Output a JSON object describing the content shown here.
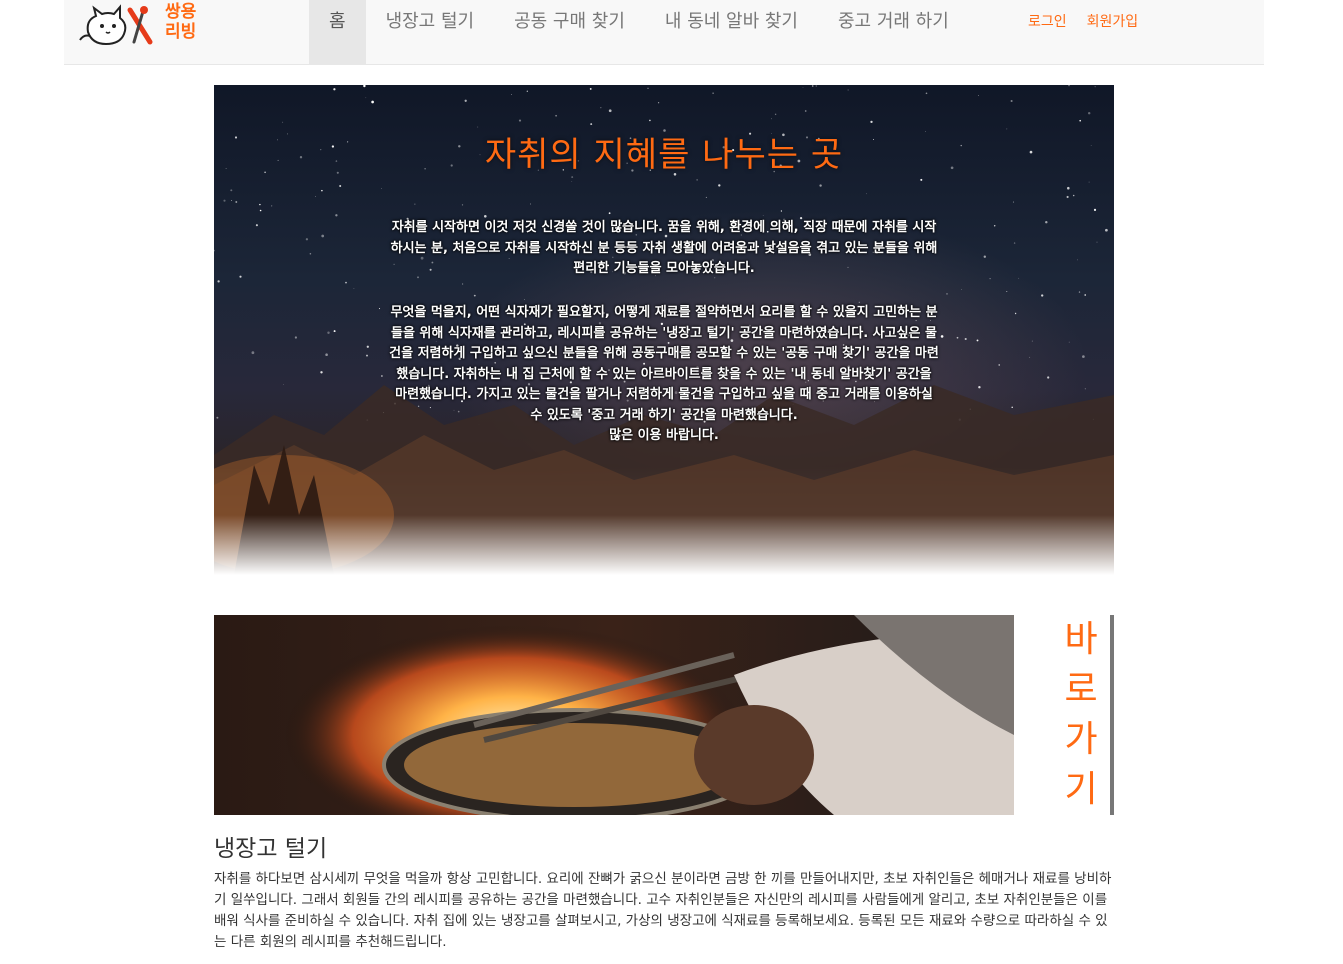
{
  "brand": {
    "logo_icon": "cat-with-utensils-logo",
    "name_line1": "쌍용",
    "name_line2": "리빙",
    "accent_color": "#ff6a13"
  },
  "nav": {
    "items": [
      {
        "label": "홈",
        "active": true
      },
      {
        "label": "냉장고 털기",
        "active": false
      },
      {
        "label": "공동 구매 찾기",
        "active": false
      },
      {
        "label": "내 동네 알바 찾기",
        "active": false
      },
      {
        "label": "중고 거래 하기",
        "active": false
      }
    ],
    "login": "로그인",
    "signup": "회원가입"
  },
  "hero": {
    "title": "자취의 지혜를 나누는 곳",
    "p1": "자취를 시작하면 이것 저것 신경쓸 것이 많습니다. 꿈을 위해, 환경에 의해, 직장 때문에 자취를 시작하시는 분, 처음으로 자취를 시작하신 분 등등 자취 생활에 어려움과 낯설음을 겪고 있는 분들을 위해 편리한 기능들을 모아놓았습니다.",
    "p2": "무엇을 먹을지, 어떤 식자재가 필요할지, 어떻게 재료를 절약하면서 요리를 할 수 있을지 고민하는 분들을 위해 식자재를 관리하고, 레시피를 공유하는 '냉장고 털기' 공간을 마련하였습니다. 사고싶은 물건을 저렴하게 구입하고 싶으신 분들을 위해 공동구매를 공모할 수 있는 '공동 구매 찾기' 공간을 마련했습니다. 자취하는 내 집 근처에 할 수 있는 아르바이트를 찾을 수 있는 '내 동네 알바찾기' 공간을 마련했습니다. 가지고 있는 물건을 팔거나 저렴하게 물건을 구입하고 싶을 때 중고 거래를 이용하실 수 있도록 '중고 거래 하기' 공간을 마련했습니다.",
    "p3": "많은 이용 바랍니다."
  },
  "feature": {
    "image_icon": "cooking-pan-flame-photo",
    "shortcut_label": "바로가기",
    "title": "냉장고 털기",
    "description": "자취를 하다보면 삼시세끼 무엇을 먹을까 항상 고민합니다. 요리에 잔뼈가 굵으신 분이라면 금방 한 끼를 만들어내지만, 초보 자취인들은 헤매거나 재료를 낭비하기 일쑤입니다. 그래서 회원들 간의 레시피를 공유하는 공간을 마련했습니다. 고수 자취인분들은 자신만의 레시피를 사람들에게 알리고, 초보 자취인분들은 이를 배워 식사를 준비하실 수 있습니다. 자취 집에 있는 냉장고를 살펴보시고, 가상의 냉장고에 식재료를 등록해보세요. 등록된 모든 재료와 수량으로 따라하실 수 있는 다른 회원의 레시피를 추천해드립니다."
  }
}
